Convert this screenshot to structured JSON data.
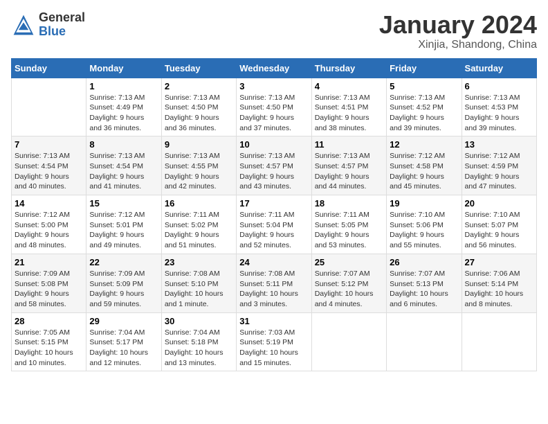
{
  "logo": {
    "general": "General",
    "blue": "Blue"
  },
  "title": "January 2024",
  "subtitle": "Xinjia, Shandong, China",
  "days_of_week": [
    "Sunday",
    "Monday",
    "Tuesday",
    "Wednesday",
    "Thursday",
    "Friday",
    "Saturday"
  ],
  "weeks": [
    [
      {
        "day": "",
        "info": ""
      },
      {
        "day": "1",
        "info": "Sunrise: 7:13 AM\nSunset: 4:49 PM\nDaylight: 9 hours\nand 36 minutes."
      },
      {
        "day": "2",
        "info": "Sunrise: 7:13 AM\nSunset: 4:50 PM\nDaylight: 9 hours\nand 36 minutes."
      },
      {
        "day": "3",
        "info": "Sunrise: 7:13 AM\nSunset: 4:50 PM\nDaylight: 9 hours\nand 37 minutes."
      },
      {
        "day": "4",
        "info": "Sunrise: 7:13 AM\nSunset: 4:51 PM\nDaylight: 9 hours\nand 38 minutes."
      },
      {
        "day": "5",
        "info": "Sunrise: 7:13 AM\nSunset: 4:52 PM\nDaylight: 9 hours\nand 39 minutes."
      },
      {
        "day": "6",
        "info": "Sunrise: 7:13 AM\nSunset: 4:53 PM\nDaylight: 9 hours\nand 39 minutes."
      }
    ],
    [
      {
        "day": "7",
        "info": ""
      },
      {
        "day": "8",
        "info": "Sunrise: 7:13 AM\nSunset: 4:54 PM\nDaylight: 9 hours\nand 41 minutes."
      },
      {
        "day": "9",
        "info": "Sunrise: 7:13 AM\nSunset: 4:55 PM\nDaylight: 9 hours\nand 42 minutes."
      },
      {
        "day": "10",
        "info": "Sunrise: 7:13 AM\nSunset: 4:57 PM\nDaylight: 9 hours\nand 43 minutes."
      },
      {
        "day": "11",
        "info": "Sunrise: 7:13 AM\nSunset: 4:57 PM\nDaylight: 9 hours\nand 44 minutes."
      },
      {
        "day": "12",
        "info": "Sunrise: 7:12 AM\nSunset: 4:58 PM\nDaylight: 9 hours\nand 45 minutes."
      },
      {
        "day": "13",
        "info": "Sunrise: 7:12 AM\nSunset: 4:59 PM\nDaylight: 9 hours\nand 47 minutes."
      }
    ],
    [
      {
        "day": "14",
        "info": ""
      },
      {
        "day": "15",
        "info": "Sunrise: 7:12 AM\nSunset: 5:01 PM\nDaylight: 9 hours\nand 49 minutes."
      },
      {
        "day": "16",
        "info": "Sunrise: 7:11 AM\nSunset: 5:02 PM\nDaylight: 9 hours\nand 51 minutes."
      },
      {
        "day": "17",
        "info": "Sunrise: 7:11 AM\nSunset: 5:04 PM\nDaylight: 9 hours\nand 52 minutes."
      },
      {
        "day": "18",
        "info": "Sunrise: 7:11 AM\nSunset: 5:05 PM\nDaylight: 9 hours\nand 53 minutes."
      },
      {
        "day": "19",
        "info": "Sunrise: 7:10 AM\nSunset: 5:06 PM\nDaylight: 9 hours\nand 55 minutes."
      },
      {
        "day": "20",
        "info": "Sunrise: 7:10 AM\nSunset: 5:07 PM\nDaylight: 9 hours\nand 56 minutes."
      }
    ],
    [
      {
        "day": "21",
        "info": ""
      },
      {
        "day": "22",
        "info": "Sunrise: 7:09 AM\nSunset: 5:09 PM\nDaylight: 9 hours\nand 59 minutes."
      },
      {
        "day": "23",
        "info": "Sunrise: 7:08 AM\nSunset: 5:10 PM\nDaylight: 10 hours\nand 1 minute."
      },
      {
        "day": "24",
        "info": "Sunrise: 7:08 AM\nSunset: 5:11 PM\nDaylight: 10 hours\nand 3 minutes."
      },
      {
        "day": "25",
        "info": "Sunrise: 7:07 AM\nSunset: 5:12 PM\nDaylight: 10 hours\nand 4 minutes."
      },
      {
        "day": "26",
        "info": "Sunrise: 7:07 AM\nSunset: 5:13 PM\nDaylight: 10 hours\nand 6 minutes."
      },
      {
        "day": "27",
        "info": "Sunrise: 7:06 AM\nSunset: 5:14 PM\nDaylight: 10 hours\nand 8 minutes."
      }
    ],
    [
      {
        "day": "28",
        "info": ""
      },
      {
        "day": "29",
        "info": "Sunrise: 7:04 AM\nSunset: 5:17 PM\nDaylight: 10 hours\nand 12 minutes."
      },
      {
        "day": "30",
        "info": "Sunrise: 7:04 AM\nSunset: 5:18 PM\nDaylight: 10 hours\nand 13 minutes."
      },
      {
        "day": "31",
        "info": "Sunrise: 7:03 AM\nSunset: 5:19 PM\nDaylight: 10 hours\nand 15 minutes."
      },
      {
        "day": "",
        "info": ""
      },
      {
        "day": "",
        "info": ""
      },
      {
        "day": "",
        "info": ""
      }
    ]
  ],
  "week0_sunday": "Sunrise: 7:13 AM\nSunset: 4:54 PM\nDaylight: 9 hours\nand 40 minutes.",
  "week1_sunday_info": "Sunrise: 7:13 AM\nSunset: 4:54 PM\nDaylight: 9 hours\nand 40 minutes.",
  "week2_sunday_info": "Sunrise: 7:12 AM\nSunset: 5:00 PM\nDaylight: 9 hours\nand 48 minutes.",
  "week3_sunday_info": "Sunrise: 7:09 AM\nSunset: 5:08 PM\nDaylight: 9 hours\nand 58 minutes.",
  "week4_sunday_info": "Sunrise: 7:05 AM\nSunset: 5:15 PM\nDaylight: 10 hours\nand 10 minutes."
}
